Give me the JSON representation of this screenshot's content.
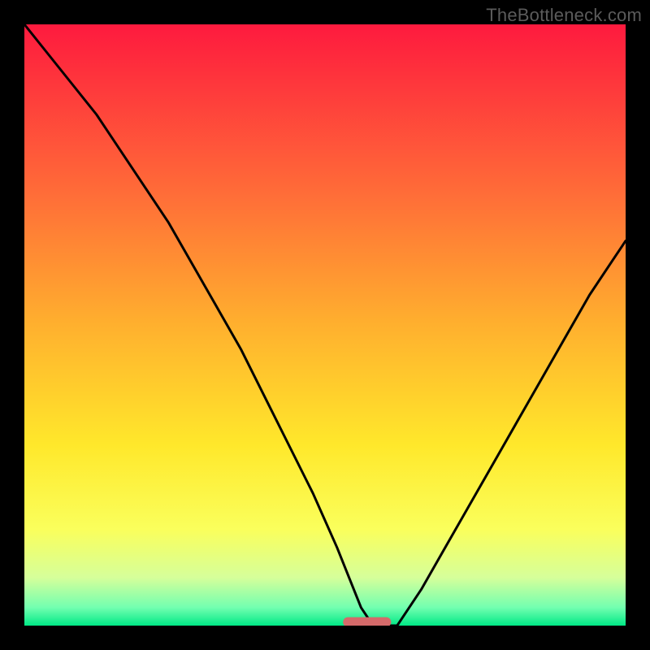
{
  "watermark": "TheBottleneck.com",
  "chart_data": {
    "type": "line",
    "title": "",
    "xlabel": "",
    "ylabel": "",
    "xlim": [
      0,
      100
    ],
    "ylim": [
      0,
      100
    ],
    "background_gradient_stops": [
      {
        "offset": 0,
        "color": "#fe1a3e"
      },
      {
        "offset": 28,
        "color": "#ff6c38"
      },
      {
        "offset": 50,
        "color": "#ffb02e"
      },
      {
        "offset": 70,
        "color": "#ffe82b"
      },
      {
        "offset": 84,
        "color": "#faff5c"
      },
      {
        "offset": 92,
        "color": "#d6ff9a"
      },
      {
        "offset": 97,
        "color": "#72ffb0"
      },
      {
        "offset": 100,
        "color": "#00e986"
      }
    ],
    "series": [
      {
        "name": "bottleneck-curve",
        "x": [
          0,
          4,
          8,
          12,
          16,
          20,
          24,
          28,
          32,
          36,
          40,
          44,
          48,
          52,
          54,
          56,
          58,
          62,
          66,
          70,
          74,
          78,
          82,
          86,
          90,
          94,
          98,
          100
        ],
        "y": [
          100,
          95,
          90,
          85,
          79,
          73,
          67,
          60,
          53,
          46,
          38,
          30,
          22,
          13,
          8,
          3,
          0,
          0,
          6,
          13,
          20,
          27,
          34,
          41,
          48,
          55,
          61,
          64
        ]
      }
    ],
    "marker": {
      "name": "optimum-marker",
      "x_center": 57,
      "y": 0.6,
      "width": 8,
      "color": "#d46a6a"
    }
  }
}
